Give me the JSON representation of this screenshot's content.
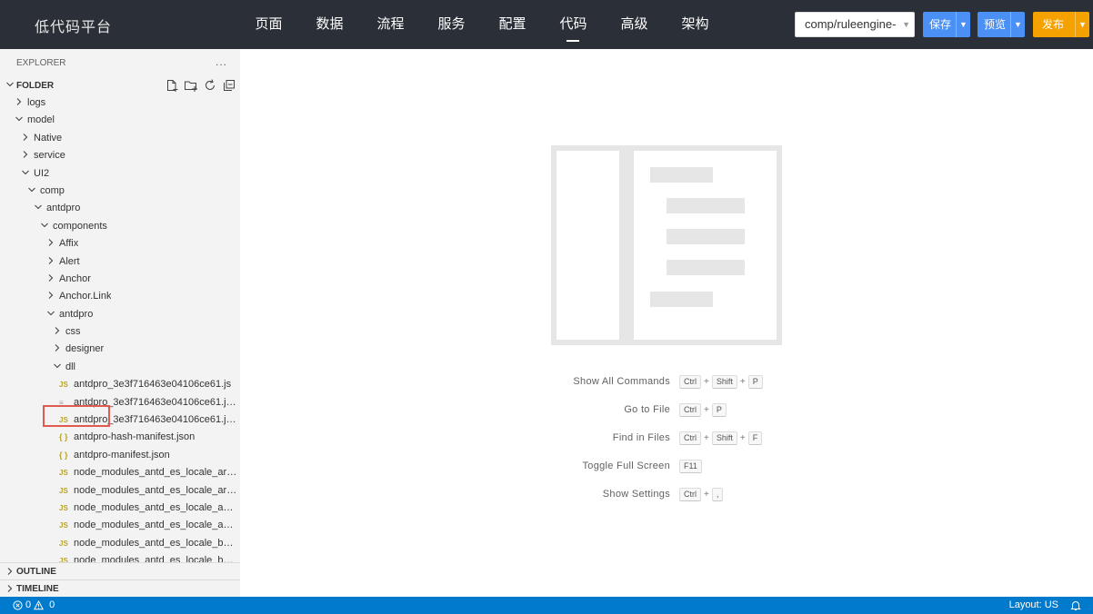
{
  "app": {
    "title": "低代码平台"
  },
  "nav": {
    "items": [
      {
        "label": "页面",
        "active": false
      },
      {
        "label": "数据",
        "active": false
      },
      {
        "label": "流程",
        "active": false
      },
      {
        "label": "服务",
        "active": false
      },
      {
        "label": "配置",
        "active": false
      },
      {
        "label": "代码",
        "active": true
      },
      {
        "label": "高级",
        "active": false
      },
      {
        "label": "架构",
        "active": false
      }
    ]
  },
  "toolbar": {
    "component_select": "comp/ruleengine-",
    "save_label": "保存",
    "preview_label": "预览",
    "publish_label": "发布",
    "colors": {
      "primary": "#4a90f5",
      "publish": "#f5a100",
      "topbar": "#2b3038",
      "statusbar": "#007acc"
    }
  },
  "sidebar": {
    "explorer_title": "EXPLORER",
    "more_label": "...",
    "folder_label": "FOLDER",
    "tree": [
      {
        "label": "logs",
        "kind": "folder",
        "depth": 1,
        "expanded": false
      },
      {
        "label": "model",
        "kind": "folder",
        "depth": 1,
        "expanded": true
      },
      {
        "label": "Native",
        "kind": "folder",
        "depth": 2,
        "expanded": false
      },
      {
        "label": "service",
        "kind": "folder",
        "depth": 2,
        "expanded": false
      },
      {
        "label": "UI2",
        "kind": "folder",
        "depth": 2,
        "expanded": true
      },
      {
        "label": "comp",
        "kind": "folder",
        "depth": 3,
        "expanded": true
      },
      {
        "label": "antdpro",
        "kind": "folder",
        "depth": 4,
        "expanded": true
      },
      {
        "label": "components",
        "kind": "folder",
        "depth": 5,
        "expanded": true
      },
      {
        "label": "Affix",
        "kind": "folder",
        "depth": 6,
        "expanded": false
      },
      {
        "label": "Alert",
        "kind": "folder",
        "depth": 6,
        "expanded": false
      },
      {
        "label": "Anchor",
        "kind": "folder",
        "depth": 6,
        "expanded": false
      },
      {
        "label": "Anchor.Link",
        "kind": "folder",
        "depth": 6,
        "expanded": false
      },
      {
        "label": "antdpro",
        "kind": "folder",
        "depth": 6,
        "expanded": true
      },
      {
        "label": "css",
        "kind": "folder",
        "depth": 7,
        "expanded": false
      },
      {
        "label": "designer",
        "kind": "folder",
        "depth": 7,
        "expanded": false
      },
      {
        "label": "dll",
        "kind": "folder",
        "depth": 7,
        "expanded": true,
        "highlighted": true
      },
      {
        "label": "antdpro_3e3f716463e04106ce61.js",
        "kind": "js",
        "depth": 8
      },
      {
        "label": "antdpro_3e3f716463e04106ce61.js...",
        "kind": "txt",
        "depth": 8
      },
      {
        "label": "antdpro_3e3f716463e04106ce61.js...",
        "kind": "js",
        "depth": 8
      },
      {
        "label": "antdpro-hash-manifest.json",
        "kind": "json",
        "depth": 8
      },
      {
        "label": "antdpro-manifest.json",
        "kind": "json",
        "depth": 8
      },
      {
        "label": "node_modules_antd_es_locale_ar_...",
        "kind": "js",
        "depth": 8
      },
      {
        "label": "node_modules_antd_es_locale_ar_...",
        "kind": "js",
        "depth": 8
      },
      {
        "label": "node_modules_antd_es_locale_az_...",
        "kind": "js",
        "depth": 8
      },
      {
        "label": "node_modules_antd_es_locale_az_...",
        "kind": "js",
        "depth": 8
      },
      {
        "label": "node_modules_antd_es_locale_bg_...",
        "kind": "js",
        "depth": 8
      },
      {
        "label": "node_modules_antd_es_locale_bg_...",
        "kind": "js",
        "depth": 8
      }
    ],
    "outline_label": "OUTLINE",
    "timeline_label": "TIMELINE"
  },
  "welcome": {
    "shortcuts": [
      {
        "name": "Show All Commands",
        "keys": [
          "Ctrl",
          "Shift",
          "P"
        ]
      },
      {
        "name": "Go to File",
        "keys": [
          "Ctrl",
          "P"
        ]
      },
      {
        "name": "Find in Files",
        "keys": [
          "Ctrl",
          "Shift",
          "F"
        ]
      },
      {
        "name": "Toggle Full Screen",
        "keys": [
          "F11"
        ]
      },
      {
        "name": "Show Settings",
        "keys": [
          "Ctrl",
          ","
        ]
      }
    ]
  },
  "statusbar": {
    "errors": "0",
    "warnings": "0",
    "layout": "Layout: US"
  }
}
